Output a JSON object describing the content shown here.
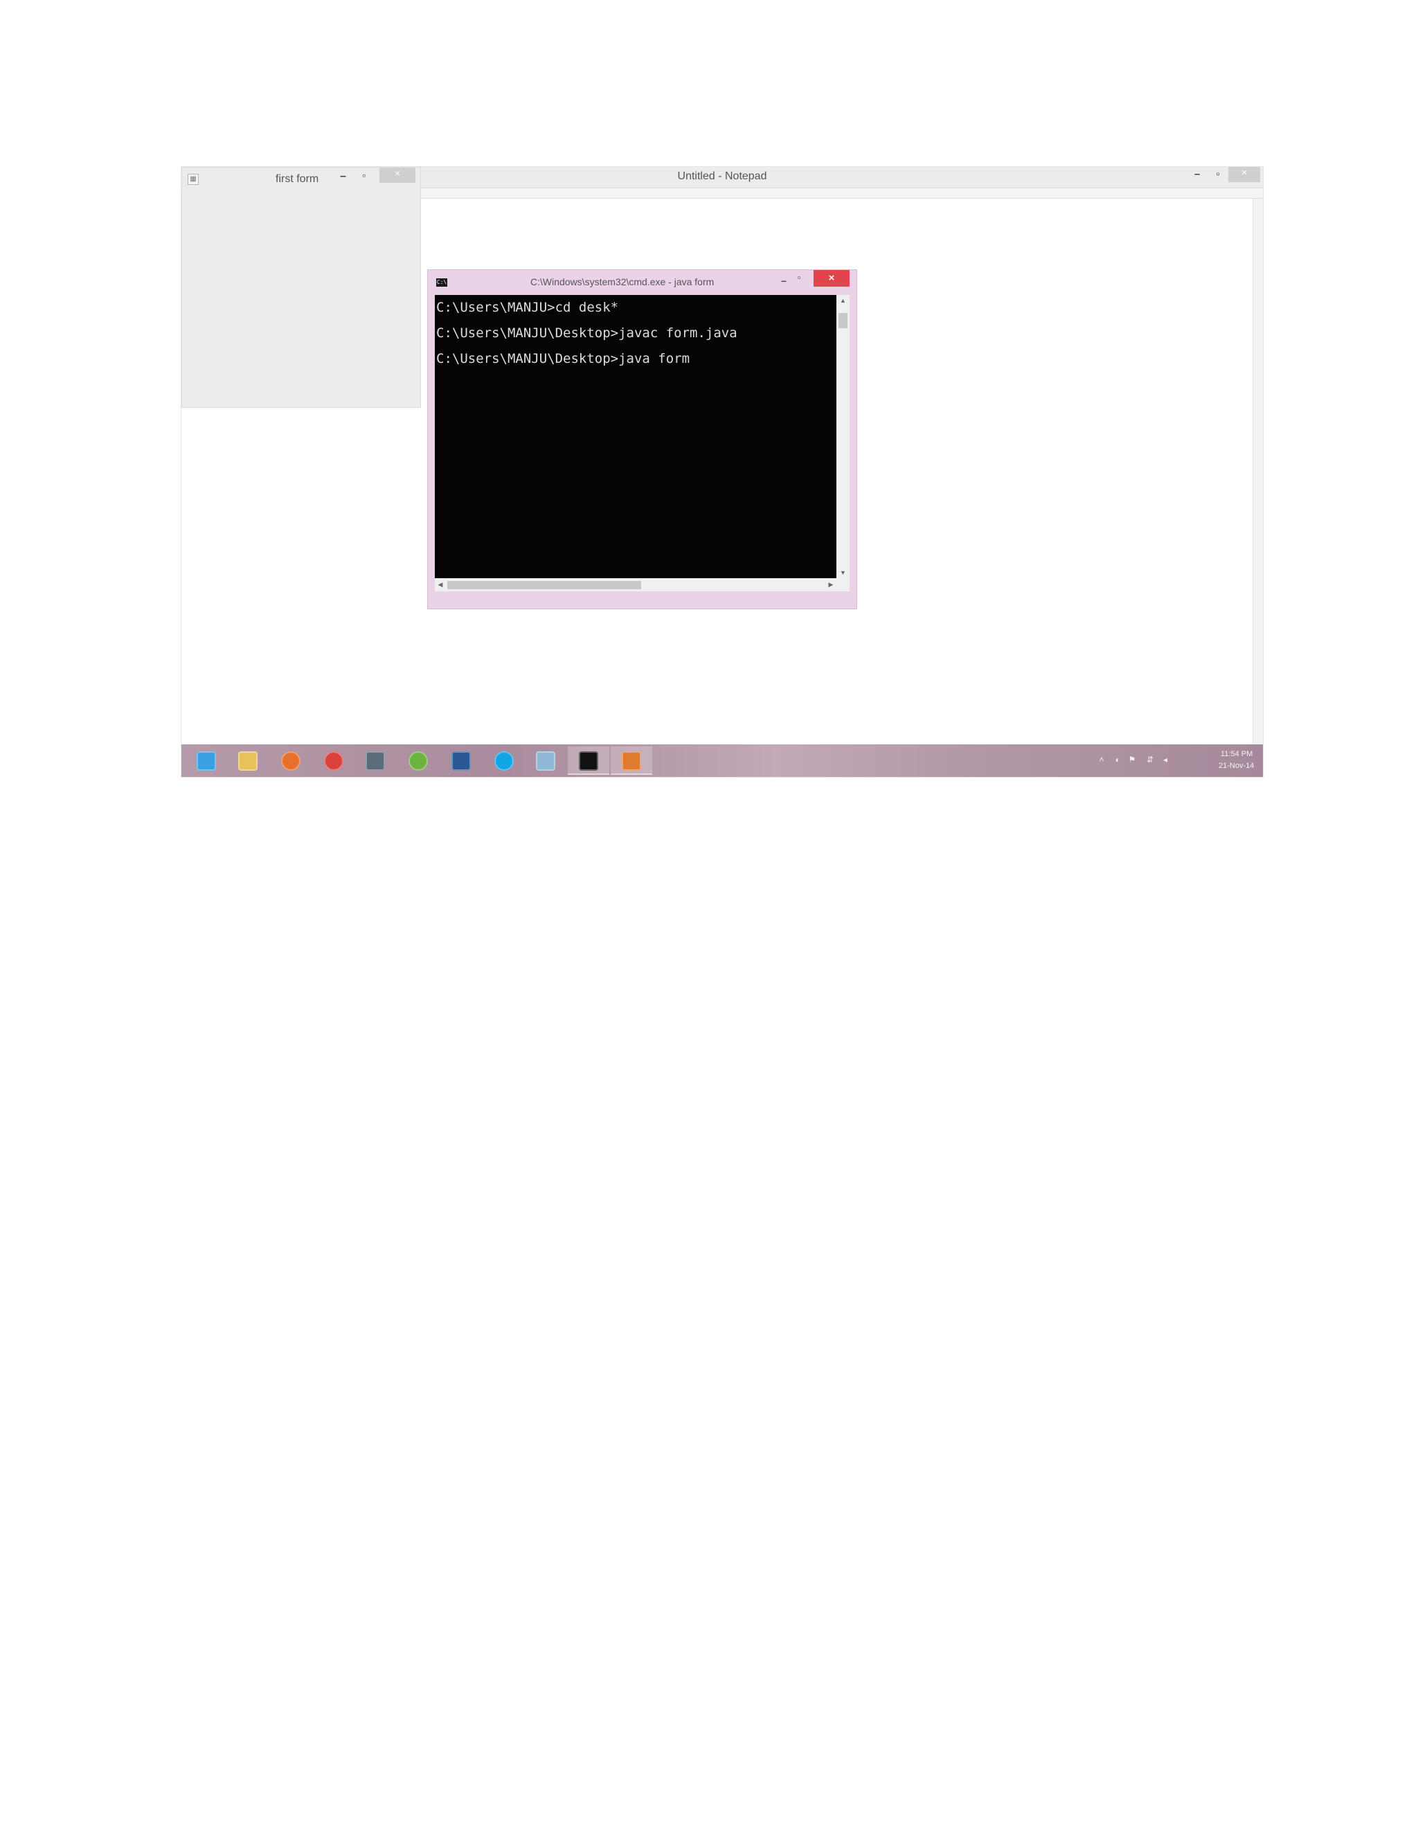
{
  "notepad": {
    "title": "Untitled - Notepad",
    "min_glyph": "–",
    "max_glyph": "▫",
    "close_glyph": "×"
  },
  "first_form": {
    "title": "first form",
    "min_glyph": "–",
    "max_glyph": "▫",
    "close_glyph": "×"
  },
  "cmd": {
    "title": "C:\\Windows\\system32\\cmd.exe - java  form",
    "icon_text": "C:\\",
    "min_glyph": "–",
    "max_glyph": "▫",
    "close_glyph": "×",
    "lines": [
      "C:\\Users\\MANJU>cd desk*",
      "C:\\Users\\MANJU\\Desktop>javac form.java",
      "C:\\Users\\MANJU\\Desktop>java form"
    ]
  },
  "taskbar": {
    "items": [
      {
        "name": "internet-explorer-icon",
        "color": "#3aa0e0"
      },
      {
        "name": "file-explorer-icon",
        "color": "#e8c35a"
      },
      {
        "name": "firefox-icon",
        "color": "#e8702a"
      },
      {
        "name": "chrome-icon",
        "color": "#d9413a"
      },
      {
        "name": "camera-icon",
        "color": "#5c6b7a"
      },
      {
        "name": "utorrent-icon",
        "color": "#6cb33f"
      },
      {
        "name": "word-icon",
        "color": "#2b5797"
      },
      {
        "name": "skype-icon",
        "color": "#12a5e6"
      },
      {
        "name": "app-icon",
        "color": "#8fb8d8"
      },
      {
        "name": "command-prompt-icon",
        "color": "#111111"
      },
      {
        "name": "java-icon",
        "color": "#e07a2f"
      }
    ],
    "tray": {
      "time": "11:54 PM",
      "date": "21-Nov-14"
    }
  },
  "colors": {
    "cmd_border": "#ead3e8",
    "cmd_close": "#e0454d",
    "console_bg": "#050305"
  }
}
